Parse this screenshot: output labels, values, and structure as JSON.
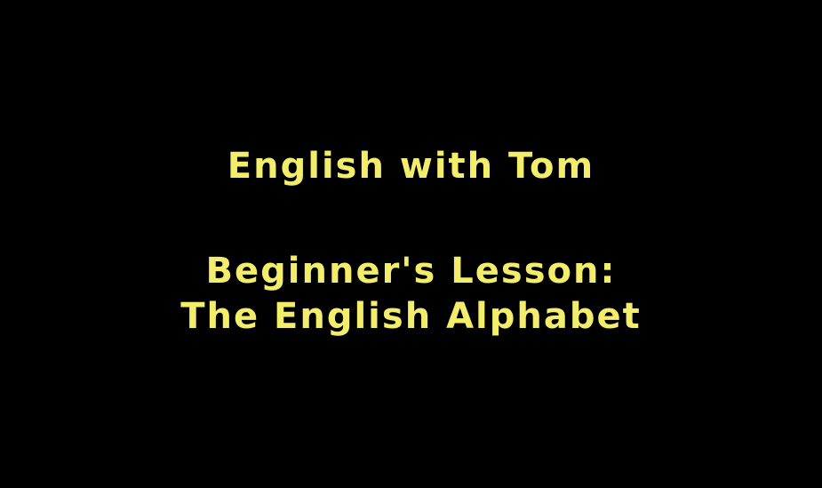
{
  "title_card": {
    "line1": "English with Tom",
    "line2": "Beginner's Lesson:",
    "line3": "The English Alphabet"
  },
  "colors": {
    "background": "#000000",
    "text": "#f3ed6c"
  }
}
